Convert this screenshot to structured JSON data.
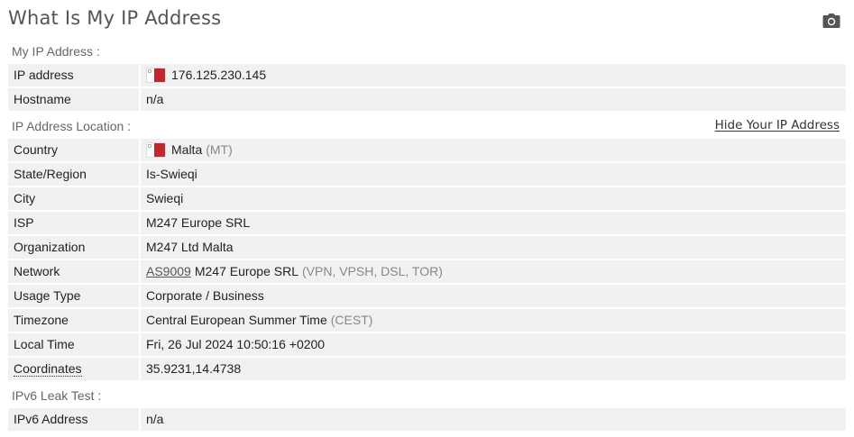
{
  "page": {
    "title": "What Is My IP Address"
  },
  "icons": {
    "camera": "camera-icon",
    "flag": "malta-flag-icon"
  },
  "sections": {
    "my_ip": "My IP Address :",
    "location": "IP Address Location :",
    "ipv6": "IPv6 Leak Test :"
  },
  "hide_link": "Hide Your IP Address",
  "ip_rows": [
    {
      "label": "IP address",
      "value": "176.125.230.145"
    },
    {
      "label": "Hostname",
      "value": "n/a"
    }
  ],
  "location_rows": {
    "country": {
      "label": "Country",
      "value": "Malta",
      "extra": "(MT)"
    },
    "state": {
      "label": "State/Region",
      "value": "Is-Swieqi"
    },
    "city": {
      "label": "City",
      "value": "Swieqi"
    },
    "isp": {
      "label": "ISP",
      "value": "M247 Europe SRL"
    },
    "organization": {
      "label": "Organization",
      "value": "M247 Ltd Malta"
    },
    "network": {
      "label": "Network",
      "link": "AS9009",
      "value": "M247 Europe SRL",
      "extra": "(VPN, VPSH, DSL, TOR)"
    },
    "usage": {
      "label": "Usage Type",
      "value": "Corporate / Business"
    },
    "timezone": {
      "label": "Timezone",
      "value": "Central European Summer Time",
      "extra": "(CEST)"
    },
    "local_time": {
      "label": "Local Time",
      "value": "Fri, 26 Jul 2024 10:50:16 +0200"
    },
    "coordinates": {
      "label": "Coordinates",
      "value": "35.9231,14.4738"
    }
  },
  "ipv6_rows": [
    {
      "label": "IPv6 Address",
      "value": "n/a"
    }
  ],
  "colors": {
    "flag_red": "#c1272d",
    "row_bg": "#f1f1f1",
    "title": "#555555"
  }
}
